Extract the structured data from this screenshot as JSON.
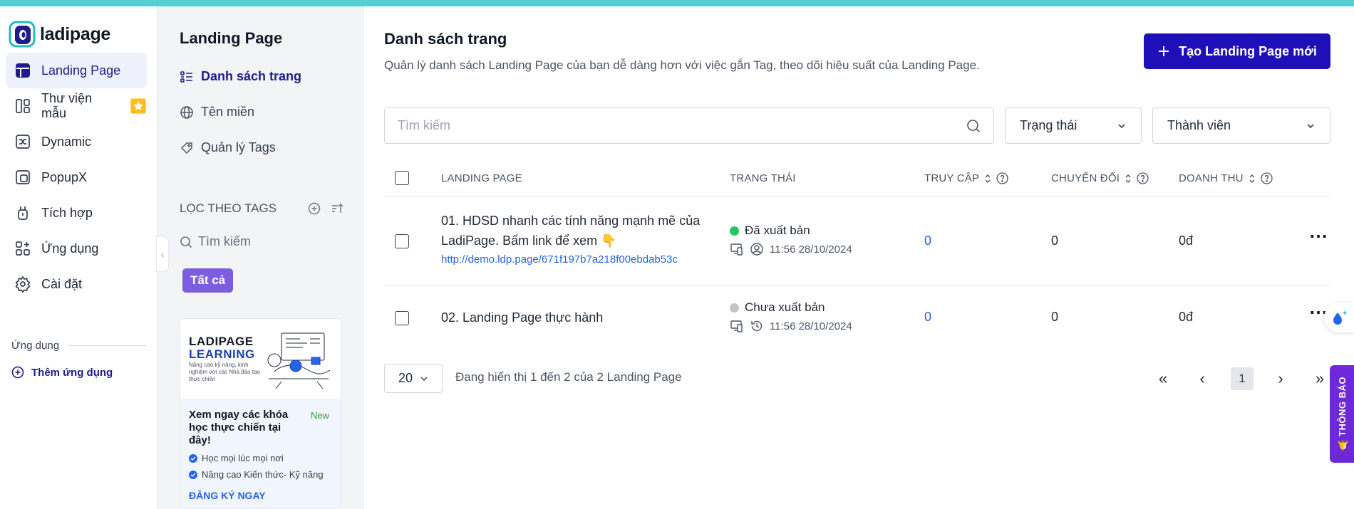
{
  "brand": {
    "name": "ladipage"
  },
  "nav": {
    "items": [
      {
        "label": "Landing Page",
        "icon": "layout-icon",
        "active": true
      },
      {
        "label": "Thư viện mẫu",
        "icon": "library-icon",
        "badge": "star"
      },
      {
        "label": "Dynamic",
        "icon": "shuffle-icon"
      },
      {
        "label": "PopupX",
        "icon": "popup-icon"
      },
      {
        "label": "Tích hợp",
        "icon": "plug-icon"
      },
      {
        "label": "Ứng dụng",
        "icon": "apps-icon"
      },
      {
        "label": "Cài đặt",
        "icon": "gear-icon"
      }
    ],
    "section_label": "Ứng dụng",
    "add_app_label": "Thêm ứng dụng"
  },
  "sub": {
    "title": "Landing Page",
    "items": [
      {
        "label": "Danh sách trang",
        "icon": "list-icon",
        "active": true
      },
      {
        "label": "Tên miền",
        "icon": "globe-icon"
      },
      {
        "label": "Quản lý Tags",
        "icon": "tag-icon"
      }
    ],
    "tags_heading": "LỌC THEO TAGS",
    "tag_search_placeholder": "Tìm kiếm",
    "tag_all_label": "Tất cả",
    "promo": {
      "brand_line1": "LADIPAGE",
      "brand_line2": "LEARNING",
      "small_text": "Nâng cao kỹ năng, kinh nghiệm với các Nhà đào tạo thực chiến",
      "heading": "Xem ngay các khóa học thực chiến tại đây!",
      "badge": "New",
      "bullets": [
        "Học mọi lúc mọi nơi",
        "Nâng cao Kiến thức- Kỹ năng"
      ],
      "cta": "ĐĂNG KÝ NGAY"
    }
  },
  "main": {
    "title": "Danh sách trang",
    "description": "Quản lý danh sách Landing Page của bạn dễ dàng hơn với việc gắn Tag, theo dõi hiệu suất của Landing Page.",
    "create_label": "Tạo Landing Page mới",
    "search_placeholder": "Tìm kiếm",
    "filter_status": "Trạng thái",
    "filter_member": "Thành viên",
    "columns": {
      "name": "LANDING PAGE",
      "status": "TRẠNG THÁI",
      "visits": "TRUY CẬP",
      "conversions": "CHUYỂN ĐỔI",
      "revenue": "DOANH THU"
    },
    "rows": [
      {
        "name": "01. HDSD nhanh các tính năng mạnh mẽ của LadiPage. Bấm link để xem 👇",
        "url": "http://demo.ldp.page/671f197b7a218f00ebdab53c",
        "status": "Đã xuất bản",
        "status_color": "#22c55e",
        "time": "11:56 28/10/2024",
        "visits": "0",
        "conversions": "0",
        "revenue": "0đ"
      },
      {
        "name": "02. Landing Page thực hành",
        "url": "",
        "status": "Chưa xuất bản",
        "status_color": "#c4c4c4",
        "time": "11:56 28/10/2024",
        "visits": "0",
        "conversions": "0",
        "revenue": "0đ"
      }
    ],
    "pager": {
      "page_size": "20",
      "info": "Đang hiển thị 1 đến 2 của 2 Landing Page",
      "current_page": "1"
    }
  },
  "notify_label": "🔔 THÔNG BÁO",
  "colors": {
    "accent": "#1e0fb8",
    "topbar": "#56cfd0",
    "tag": "#7c5ce0"
  }
}
